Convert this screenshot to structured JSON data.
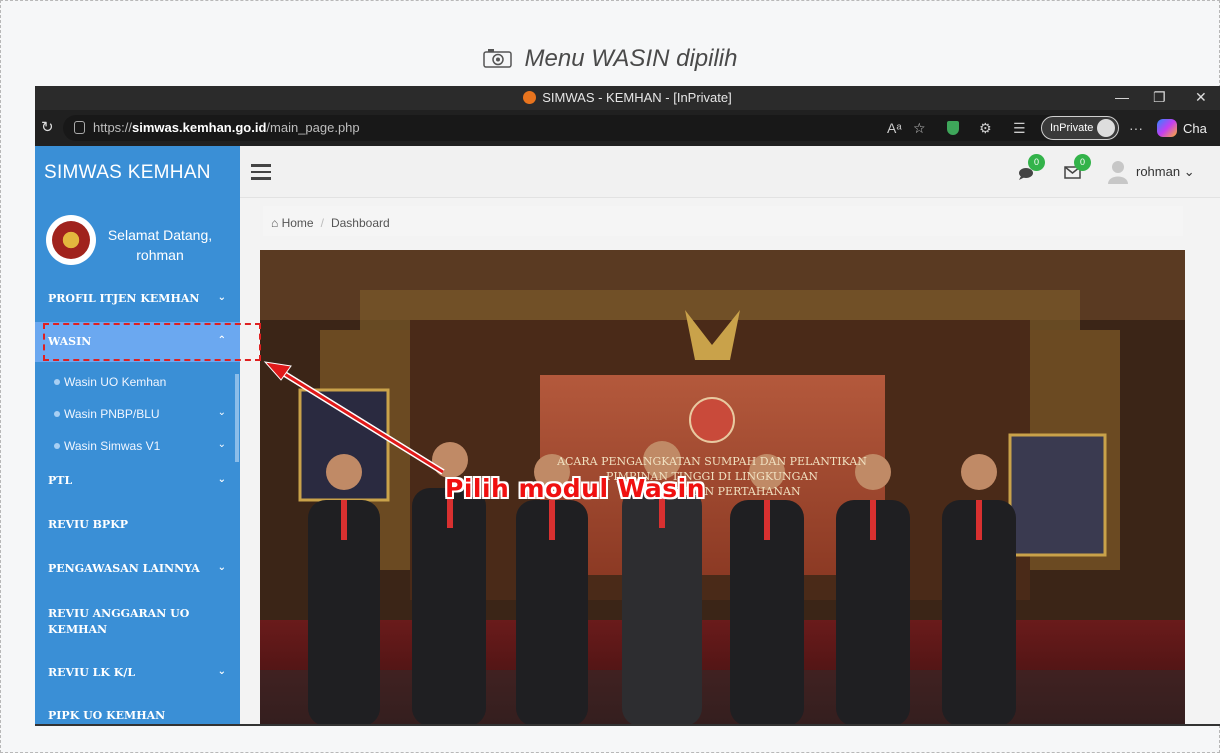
{
  "caption": {
    "text": "Menu WASIN dipilih"
  },
  "browser": {
    "title": "SIMWAS - KEMHAN - [InPrivate]",
    "url_prefix": "https://",
    "url_domain": "simwas.kemhan.go.id",
    "url_path": "/main_page.php",
    "inprivate_label": "InPrivate",
    "copilot_label": "Cha",
    "more_label": "···"
  },
  "app": {
    "brand": "SIMWAS KEMHAN",
    "greeting_line1": "Selamat Datang,",
    "greeting_line2": "rohman",
    "header_user": "rohman",
    "chat_badge": "0",
    "mail_badge": "0",
    "breadcrumb": {
      "home": "Home",
      "current": "Dashboard"
    }
  },
  "sidebar": {
    "menu": [
      {
        "label": "PROFIL ITJEN KEMHAN",
        "chevron": "down"
      },
      {
        "label": "WASIN",
        "chevron": "up",
        "active": true
      },
      {
        "label": "PTL",
        "chevron": "down"
      },
      {
        "label": "REVIU BPKP",
        "chevron": ""
      },
      {
        "label": "PENGAWASAN LAINNYA",
        "chevron": "down"
      },
      {
        "label_line1": "REVIU ANGGARAN UO",
        "label_line2": "KEMHAN",
        "chevron": ""
      },
      {
        "label": "REVIU LK K/L",
        "chevron": "down"
      },
      {
        "label": "PIPK UO KEMHAN",
        "chevron": ""
      }
    ],
    "wasin_sub": [
      {
        "label": "Wasin UO Kemhan",
        "chevron": ""
      },
      {
        "label": "Wasin PNBP/BLU",
        "chevron": "down"
      },
      {
        "label": "Wasin Simwas V1",
        "chevron": "down"
      }
    ]
  },
  "photo_banner": {
    "line1": "ACARA PENGANGKATAN SUMPAH DAN PELANTIKAN",
    "line2": "PIMPINAN TINGGI DI LINGKUNGAN",
    "line3": "KEMENTERIAN PERTAHANAN"
  },
  "annotation": {
    "text": "Pilih modul Wasin",
    "color": "#f01010"
  },
  "colors": {
    "sidebar": "#3a8fd6",
    "active_item": "#6ba8f0",
    "badge": "#33b34a"
  },
  "icons": {
    "chevron_down": "⌄",
    "chevron_up": "⌃",
    "home": "⌂"
  }
}
